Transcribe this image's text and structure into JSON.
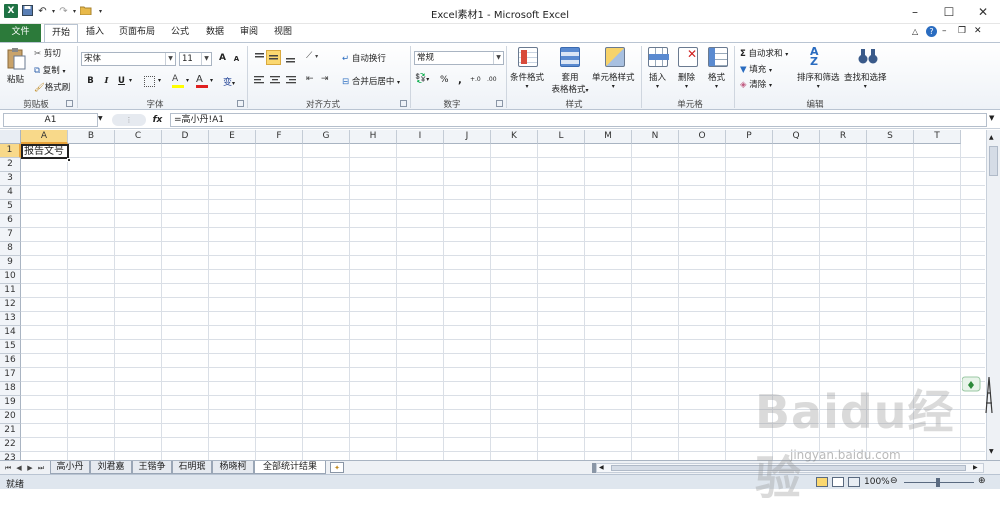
{
  "window": {
    "title": "Excel素材1 - Microsoft Excel",
    "minimize_glyph": "–",
    "maximize_glyph": "☐",
    "close_glyph": "✕"
  },
  "tabs": [
    {
      "label": "文件"
    },
    {
      "label": "开始"
    },
    {
      "label": "插入"
    },
    {
      "label": "页面布局"
    },
    {
      "label": "公式"
    },
    {
      "label": "数据"
    },
    {
      "label": "审阅"
    },
    {
      "label": "视图"
    }
  ],
  "ribbon": {
    "clipboard": {
      "paste": "粘贴",
      "cut": "剪切",
      "copy": "复制",
      "format_painter": "格式刷",
      "group": "剪贴板"
    },
    "font": {
      "name": "宋体",
      "size": "11",
      "bold": "B",
      "italic": "I",
      "underline": "U",
      "group": "字体",
      "grow": "A",
      "shrink": "A",
      "fill": "A",
      "color": "A",
      "wen": "变"
    },
    "alignment": {
      "wrap": "自动换行",
      "merge": "合并后居中",
      "group": "对齐方式"
    },
    "number": {
      "format": "常规",
      "percent": "%",
      "comma": ",",
      "inc": "+.0",
      "dec": ".00",
      "group": "数字"
    },
    "styles": {
      "conditional": "条件格式",
      "table_1": "套用",
      "table_2": "表格格式",
      "cell": "单元格样式",
      "group": "样式"
    },
    "cells": {
      "insert": "插入",
      "delete": "删除",
      "format": "格式",
      "group": "单元格"
    },
    "editing": {
      "autosum": "自动求和",
      "fill": "填充",
      "clear": "清除",
      "sort": "排序和筛选",
      "find": "查找和选择",
      "group": "编辑"
    }
  },
  "formula_bar": {
    "name_box": "A1",
    "fx": "fx",
    "formula": "=高小丹!A1"
  },
  "columns": [
    "A",
    "B",
    "C",
    "D",
    "E",
    "F",
    "G",
    "H",
    "I",
    "J",
    "K",
    "L",
    "M",
    "N",
    "O",
    "P",
    "Q",
    "R",
    "S",
    "T"
  ],
  "rows": [
    "1",
    "2",
    "3",
    "4",
    "5",
    "6",
    "7",
    "8",
    "9",
    "10",
    "11",
    "12",
    "13",
    "14",
    "15",
    "16",
    "17",
    "18",
    "19",
    "20",
    "21",
    "22",
    "23"
  ],
  "active_cell_value": "报告文号",
  "sheets": [
    "高小丹",
    "刘君嘉",
    "王锴争",
    "石明珉",
    "杨晓柯",
    "全部统计结果"
  ],
  "active_sheet_index": 5,
  "status": {
    "ready": "就绪",
    "zoom": "100%"
  },
  "watermark": {
    "main": "Baidu经验",
    "sub": "jingyan.baidu.com"
  },
  "colors": {
    "file_tab": "#2c7a3a",
    "selection_header": "#f8d98a",
    "excel_green": "#1f7244"
  }
}
